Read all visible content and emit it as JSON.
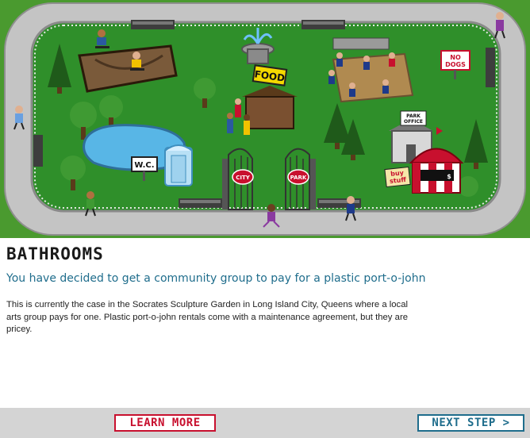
{
  "scene": {
    "signs": {
      "food": "FOOD",
      "no_dogs_line1": "NO",
      "no_dogs_line2": "DOGS",
      "park_office_line1": "PARK",
      "park_office_line2": "OFFICE",
      "wc": "W.C.",
      "city": "CITY",
      "park": "PARK",
      "buy_stuff_line1": "buy",
      "buy_stuff_line2": "stuff",
      "booth": "$"
    }
  },
  "content": {
    "heading": "BATHROOMS",
    "subheading": "You have decided to get a community group to pay for a plastic port-o-john",
    "body": "This is currently the case in the Socrates Sculpture Garden in Long Island City, Queens where a local arts group pays for one. Plastic port-o-john rentals come with a maintenance agreement, but they are pricey."
  },
  "footer": {
    "learn_more": "LEARN MORE",
    "next_step": "NEXT STEP >"
  },
  "colors": {
    "grass": "#2f8f2a",
    "path": "#b9b9b9",
    "accent_red": "#c8102e",
    "accent_blue": "#1f6d8c"
  }
}
